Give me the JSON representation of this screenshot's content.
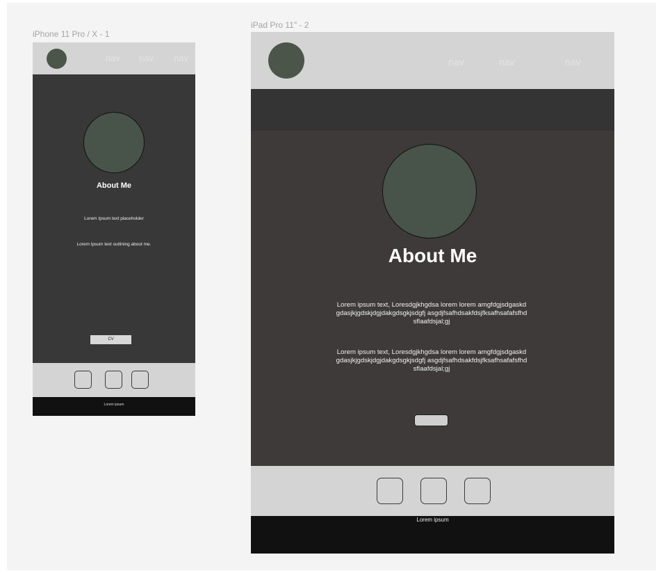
{
  "canvas_bg": "#f4f4f4",
  "colors": {
    "header_bg": "#d4d4d4",
    "body_bg_phone": "#383838",
    "body_bg_tablet": "#3f3a3a",
    "banner_bg_tablet": "#343434",
    "footer_bg": "#111111",
    "avatar": "#48534a",
    "button": "#cfcfcf"
  },
  "phone": {
    "frame_label": "iPhone 11 Pro / X - 1",
    "nav": [
      "nav",
      "nav",
      "nav"
    ],
    "title": "About Me",
    "text1": "Lorem Ipsum text placeholder",
    "text2": "Lorem Ipsum text outlining about me.",
    "cv_button": "CV",
    "social_icons": [
      "social-icon-1",
      "social-icon-2",
      "social-icon-3"
    ],
    "footer": "Lorem ipsum"
  },
  "tablet": {
    "frame_label": "iPad Pro 11\" - 2",
    "nav": [
      "nav",
      "nav",
      "nav"
    ],
    "title": "About Me",
    "para1": "Lorem ipsum text, Loresdgjkhgdsa lorem lorem amgfdgjsdgaskdgdasjkjgdskjdgjdakgdsgkjsdgfj asgdjfsafhdsakfdsjfksafhsafafsfhdsflaafdsjal;gj",
    "para2": "Lorem ipsum text, Loresdgjkhgdsa lorem lorem amgfdgjsdgaskdgdasjkjgdskjdgjdakgdsgkjsdgfj asgdjfsafhdsakfdsjfksafhsafafsfhdsflaafdsjal;gj",
    "social_icons": [
      "social-icon-1",
      "social-icon-2",
      "social-icon-3"
    ],
    "footer": "Lorem ipsum"
  }
}
